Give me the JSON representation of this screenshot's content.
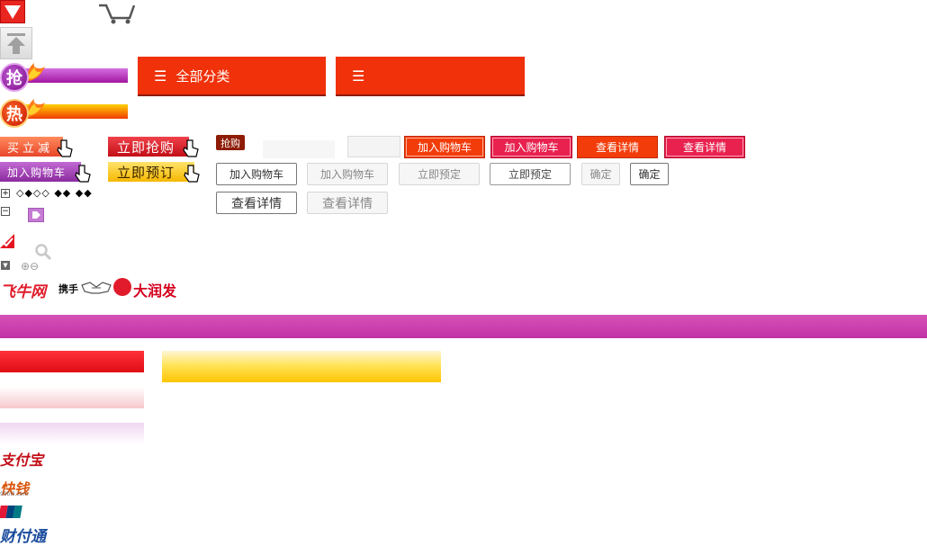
{
  "categories_bar": {
    "label": "全部分类",
    "menu_glyph": "☰"
  },
  "badges": {
    "rush_char": "抢",
    "hot_char": "热"
  },
  "mini_buttons": {
    "buy_now": "买立减",
    "add_cart": "加入购物车",
    "rush_buy": "立即抢购",
    "reserve": "立即预订"
  },
  "small_tag": "抢购",
  "buttons": {
    "add_cart_red1": "加入购物车",
    "add_cart_red2": "加入购物车",
    "view_detail_red1": "查看详情",
    "view_detail_red2": "查看详情",
    "add_cart_white": "加入购物车",
    "add_cart_grey": "加入购物车",
    "reserve_grey": "立即预定",
    "reserve_white": "立即预定",
    "confirm_grey": "确定",
    "confirm_white": "确定",
    "view_detail_white": "查看详情",
    "view_detail_grey": "查看详情"
  },
  "tiny_icons": {
    "plus": "+",
    "minus": "−",
    "arrows": "◇◆◇◇  ◆◆ ◆◆",
    "zoom": "⊕⊖"
  },
  "partners": {
    "feiniu": "飞牛网",
    "xieshou": "携手",
    "runfa": "大润发"
  },
  "payments": {
    "alipay": "支付宝",
    "kuaiqian": "快钱",
    "kuaiqian_sub": "99bill.com",
    "tenpay": "财付通"
  },
  "colors": {
    "accent_red": "#f0310a",
    "magenta": "#c132a5",
    "rose": "#e8214f"
  }
}
